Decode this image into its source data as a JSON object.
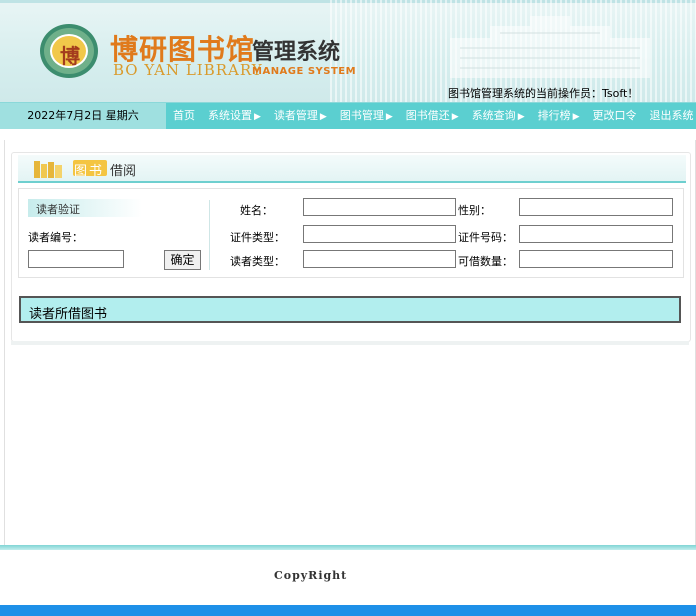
{
  "header": {
    "logo_chinese": "博研图书馆",
    "logo_system": "管理系统",
    "logo_english": "BO YAN LIBRARY",
    "logo_english_sub": "MANAGE SYSTEM",
    "logo_seal_char": "博",
    "operator_text": "图书馆管理系统的当前操作员：Tsoft！"
  },
  "navbar": {
    "date": "2022年7月2日  星期六",
    "items": [
      {
        "label": "首页",
        "arrow": false
      },
      {
        "label": "系统设置",
        "arrow": true
      },
      {
        "label": "读者管理",
        "arrow": true
      },
      {
        "label": "图书管理",
        "arrow": true
      },
      {
        "label": "图书借还",
        "arrow": true
      },
      {
        "label": "系统查询",
        "arrow": true
      },
      {
        "label": "排行榜",
        "arrow": true
      },
      {
        "label": "更改口令",
        "arrow": false
      },
      {
        "label": "退出系统",
        "arrow": false
      }
    ]
  },
  "panel": {
    "title_highlight": "图书",
    "title_rest": "借阅",
    "verify_label": "读者验证",
    "reader_id_label": "读者编号：",
    "reader_id_value": "",
    "confirm_button": "确定",
    "fields": {
      "name_label": "姓名：",
      "gender_label": "性别：",
      "id_type_label": "证件类型：",
      "id_number_label": "证件号码：",
      "reader_type_label": "读者类型：",
      "borrow_count_label": "可借数量："
    },
    "borrowed_books_title": "读者所借图书"
  },
  "footer": {
    "copyright": "CopyRight"
  }
}
